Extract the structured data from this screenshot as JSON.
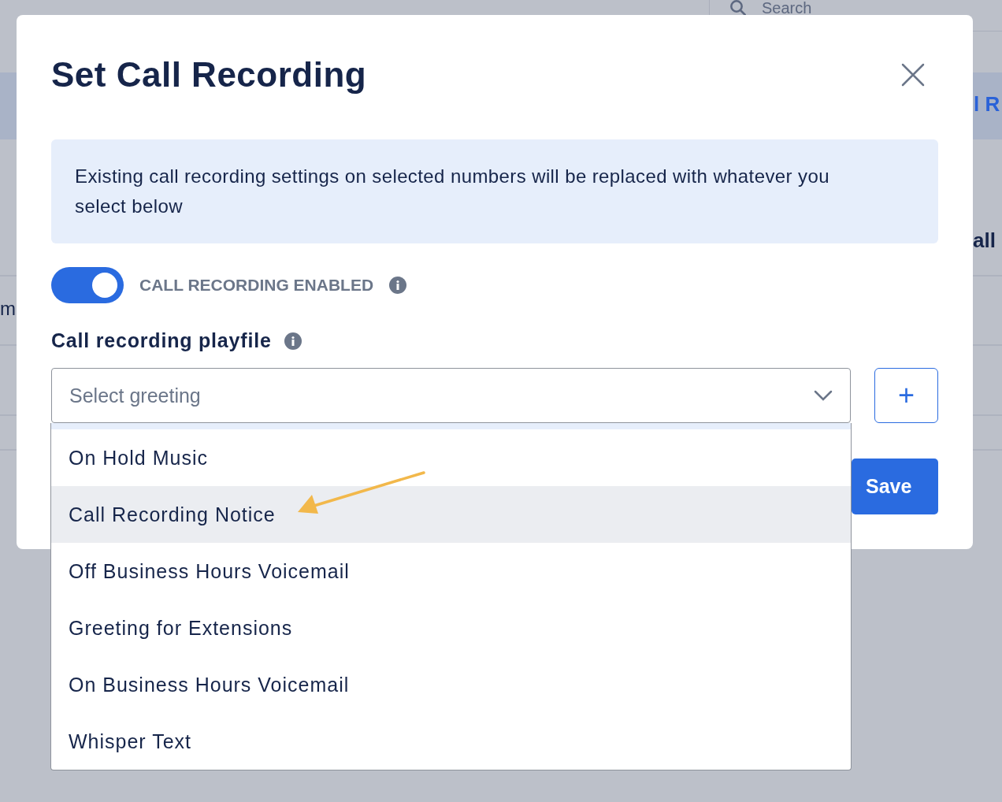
{
  "background": {
    "search": {
      "placeholder": "Search"
    },
    "header_fragment": "l R",
    "column_fragment": "all",
    "row_fragment": "m"
  },
  "dialog": {
    "title": "Set Call Recording",
    "notice": "Existing call recording settings on selected numbers will be replaced with whatever you select below",
    "toggle": {
      "label": "CALL RECORDING ENABLED",
      "on": true
    },
    "playfile": {
      "label": "Call recording playfile",
      "placeholder": "Select greeting",
      "add_button": "+",
      "options": [
        {
          "label": "On Hold Music",
          "selected": false
        },
        {
          "label": "Call Recording Notice",
          "selected": true
        },
        {
          "label": "Off Business Hours Voicemail",
          "selected": false
        },
        {
          "label": "Greeting for Extensions",
          "selected": false
        },
        {
          "label": "On Business Hours Voicemail",
          "selected": false
        },
        {
          "label": "Whisper Text",
          "selected": false
        }
      ]
    },
    "save_button": "Save"
  }
}
